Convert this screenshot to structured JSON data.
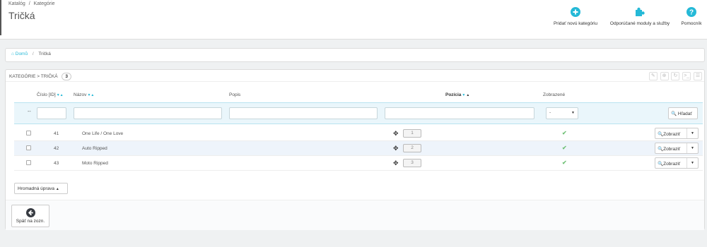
{
  "header": {
    "breadcrumb": [
      "Katalóg",
      "Kategórie"
    ],
    "breadcrumb_sep": "/",
    "title": "Tričká",
    "toolbar": {
      "add_category": "Pridať novú kategóriu",
      "recommended_modules": "Odporúčané moduly a služby",
      "help": "Pomocník"
    }
  },
  "nav_breadcrumb": {
    "home": "Domů",
    "sep": "/",
    "current": "Tričká"
  },
  "panel": {
    "heading": "KATEGÓRIE > TRIČKÁ",
    "count": "3",
    "header_icons": [
      "edit-icon",
      "add-icon",
      "refresh-icon",
      "sql-icon",
      "database-icon"
    ],
    "columns": {
      "id": "Číslo [ID]",
      "name": "Názov",
      "description": "Popis",
      "position": "Pozícia",
      "displayed": "Zobrazené"
    },
    "filters": {
      "dash": "--",
      "id": "",
      "name": "",
      "description": "",
      "position": "",
      "displayed_selected": "-",
      "search_label": "Hľadať"
    },
    "rows": [
      {
        "id": "41",
        "name": "One Life / One Love",
        "position": "1",
        "displayed": true,
        "action": "Zobraziť"
      },
      {
        "id": "42",
        "name": "Auto Ripped",
        "position": "2",
        "displayed": true,
        "action": "Zobraziť"
      },
      {
        "id": "43",
        "name": "Moto Ripped",
        "position": "3",
        "displayed": true,
        "action": "Zobraziť"
      }
    ],
    "bulk_action": "Hromadná úprava",
    "back_label": "Späť na zozn."
  },
  "colors": {
    "accent": "#25b9d7",
    "check": "#72c279",
    "text": "#555555"
  }
}
